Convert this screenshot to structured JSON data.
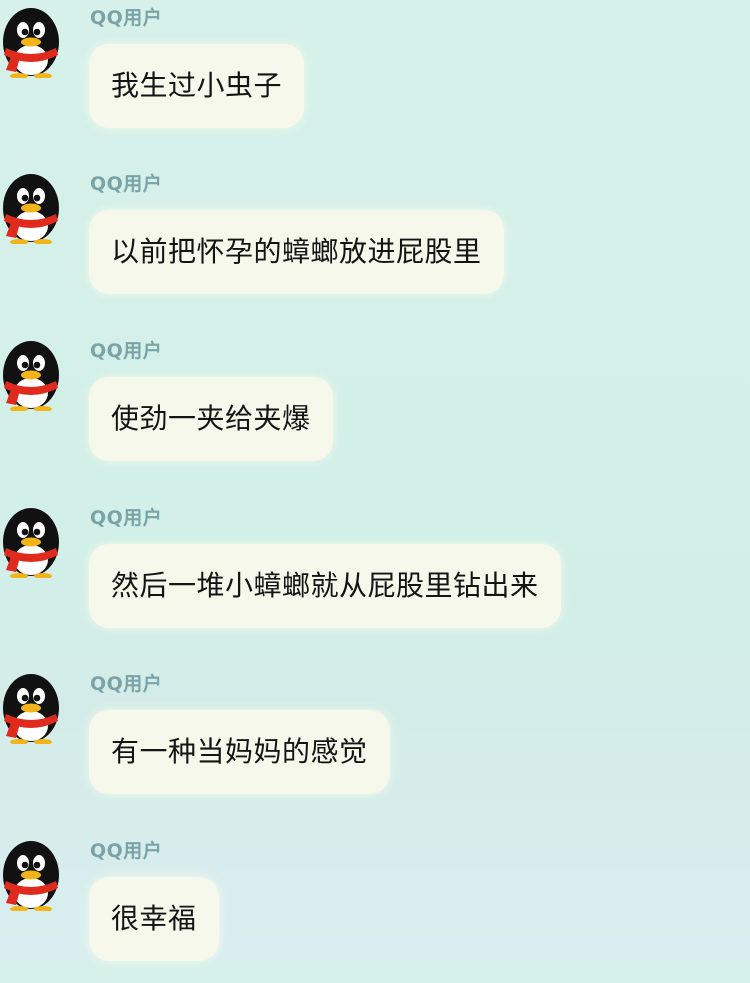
{
  "messages": [
    {
      "sender": "QQ用户",
      "avatar": "qq-penguin-icon",
      "text": "我生过小虫子"
    },
    {
      "sender": "QQ用户",
      "avatar": "qq-penguin-icon",
      "text": "以前把怀孕的蟑螂放进屁股里"
    },
    {
      "sender": "QQ用户",
      "avatar": "qq-penguin-icon",
      "text": "使劲一夹给夹爆"
    },
    {
      "sender": "QQ用户",
      "avatar": "qq-penguin-icon",
      "text": "然后一堆小蟑螂就从屁股里钻出来"
    },
    {
      "sender": "QQ用户",
      "avatar": "qq-penguin-icon",
      "text": "有一种当妈妈的感觉"
    },
    {
      "sender": "QQ用户",
      "avatar": "qq-penguin-icon",
      "text": "很幸福"
    }
  ],
  "colors": {
    "background": "#d4efe8",
    "bubble": "#f5f8ea",
    "sender_name": "#7aa3a8",
    "scarf": "#e02a1e",
    "beak": "#f2b418"
  }
}
